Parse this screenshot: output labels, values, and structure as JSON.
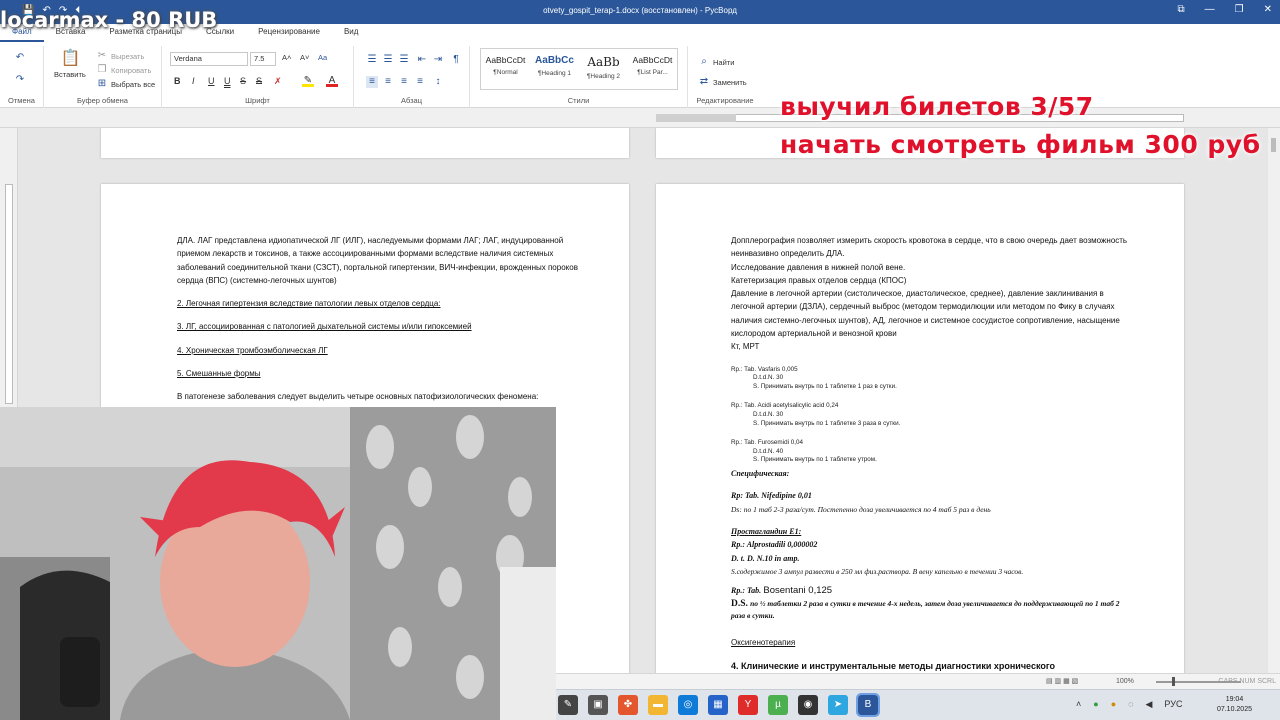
{
  "window": {
    "title": "otvety_gospit_terap-1.docx (восстановлен) - РусВорд",
    "controls": [
      "⧉",
      "—",
      "❐",
      "✕"
    ]
  },
  "quick_access": [
    "💾",
    "↶",
    "↷",
    "⏴"
  ],
  "tabs": [
    {
      "label": "Файл"
    },
    {
      "label": "Вставка"
    },
    {
      "label": "Разметка страницы"
    },
    {
      "label": "Ссылки"
    },
    {
      "label": "Рецензирование"
    },
    {
      "label": "Вид"
    }
  ],
  "ribbon": {
    "undo": {
      "label": "Отмена"
    },
    "clipboard": {
      "paste": "Вставить",
      "cut": "Вырезать",
      "copy": "Копировать",
      "select_all": "Выбрать все",
      "group": "Буфер обмена"
    },
    "font": {
      "family": "Verdana",
      "size": "7.5",
      "grow": "A˄",
      "shrink": "A˅",
      "case": "Aa",
      "bold": "B",
      "italic": "I",
      "underline": "U",
      "double_underline": "U",
      "strike": "S",
      "strike2": "S",
      "clear": "✗",
      "group": "Шрифт"
    },
    "paragraph": {
      "group": "Абзац"
    },
    "styles": {
      "items": [
        {
          "sample": "AaBbCcDt",
          "name": "¶Normal"
        },
        {
          "sample": "AaBbCc",
          "name": "¶Heading 1"
        },
        {
          "sample": "AaBb",
          "name": "¶Heading 2"
        },
        {
          "sample": "AaBbCcDt",
          "name": "¶List Par..."
        }
      ],
      "group": "Стили"
    },
    "editing": {
      "find": "Найти",
      "replace": "Заменить",
      "group": "Редактирование"
    }
  },
  "left_page": {
    "para1": "ДЛА. ЛАГ представлена идиопатической ЛГ (ИЛГ), наследуемыми формами ЛАГ; ЛАГ, индуцированной приемом лекарств и токсинов, а также ассоциированными формами вследствие наличия системных заболеваний соединительной ткани (СЗСТ), портальной гипертензии, ВИЧ-инфекции, врожденных пороков сердца (ВПС) (системно-легочных шунтов)",
    "item2": "2. Легочная гипертензия вследствие патологии левых отделов сердца:",
    "item3": "3. ЛГ, ассоциированная с патологией дыхательной системы и/или гипоксемией",
    "item4": "4. Хроническая тромбоэмболическая ЛГ",
    "item5": "5. Смешанные формы",
    "pathogenesis": "В патогенезе заболевания следует выделить четыре основных патофизиологических феномена:"
  },
  "right_page": {
    "lines": [
      "Допплерография позволяет измерить скорость кровотока в сердце, что в свою очередь дает возможность неинвазивно определить ДЛА.",
      "Исследование давления в нижней полой вене.",
      "Катетеризация правых отделов сердца (КПОС)",
      "Давление в легочной артерии (систолическое, диастолическое, среднее), давление заклинивания в легочной артерии (ДЗЛА), сердечный выброс (методом термодилюции или методом по Фику в случаях наличия системно-легочных шунтов), АД, легочное и системное сосудистое сопротивление, насыщение кислородом артериальной и венозной крови",
      "Кт, МРТ"
    ],
    "rx": [
      {
        "rp": "Rp.: Tab. Vasfaris 0,005",
        "dtd": "D.t.d.N. 30",
        "s": "S. Принимать внутрь по 1 таблетке 1 раз в сутки."
      },
      {
        "rp": "Rp.: Tab. Acidi acetylsalicylic acid 0,24",
        "dtd": "D.t.d.N. 30",
        "s": "S. Принимать внутрь по 1 таблетке 3 раза в сутки."
      },
      {
        "rp": "Rp.: Tab. Furosemidi 0,04",
        "dtd": "D.t.d.N. 40",
        "s": "S. Принимать внутрь по 1 таблетке утром."
      }
    ],
    "specific": "Специфическая:",
    "nifedipine": {
      "rp": "Rp: Tab. Nifedipine 0,01",
      "ds": "Ds: по 1 таб 2-3 раза/сут. Постепенно доза увеличивается по 4 таб 5 раз в день"
    },
    "prostaglandin": {
      "title": "Простагландин Е1:",
      "rp": "Rp.: Alprostadili 0,000002",
      "dtd": "D. t. D. N.10 in amp.",
      "s": "S.содержимое 3 ампул развести в 250 мл физ.раствора. В вену капельно в течении 3 часов."
    },
    "bosentan": {
      "rp_label": "Rp.: Tab.",
      "rp_name": "Bosentani 0,125",
      "ds_label": "D.S.",
      "ds": "по ½ таблетки 2 раза в сутки в течение 4-х недель, затем доза увеличивается до поддерживающей по 1 таб 2 раза в сутки."
    },
    "oxygen": "Оксигенотерапия",
    "heading4": "4. Клинические и инструментальные методы диагностики хронического"
  },
  "statusbar": {
    "zoom": "100%",
    "locks": "CAPS NUM SCRL"
  },
  "taskbar": {
    "icons": [
      {
        "name": "pen-icon",
        "glyph": "✎",
        "color": "#444444"
      },
      {
        "name": "monitor-icon",
        "glyph": "▣",
        "color": "#555555"
      },
      {
        "name": "colorful-app-icon",
        "glyph": "✤",
        "color": "#e4572e"
      },
      {
        "name": "folder-icon",
        "glyph": "▬",
        "color": "#f2b632"
      },
      {
        "name": "edge-icon",
        "glyph": "◎",
        "color": "#0f7bd8"
      },
      {
        "name": "store-icon",
        "glyph": "▦",
        "color": "#2563c9"
      },
      {
        "name": "yandex-icon",
        "glyph": "Y",
        "color": "#e02b2b"
      },
      {
        "name": "torrent-icon",
        "glyph": "µ",
        "color": "#4caf50"
      },
      {
        "name": "obs-icon",
        "glyph": "◉",
        "color": "#333333"
      },
      {
        "name": "telegram-icon",
        "glyph": "➤",
        "color": "#2ea6e0"
      },
      {
        "name": "word-icon",
        "glyph": "B",
        "color": "#2b579a"
      }
    ],
    "lang": "РУС",
    "time": "19:04",
    "date": "07.10.2025"
  },
  "overlay": {
    "line1": "выучил билетов 3/57",
    "line2": "начать смотреть фильм 300 руб"
  },
  "donation": "locarmax - 80 RUB",
  "colors": {
    "accent": "#2b579a",
    "overlay_red": "#e0112b"
  }
}
